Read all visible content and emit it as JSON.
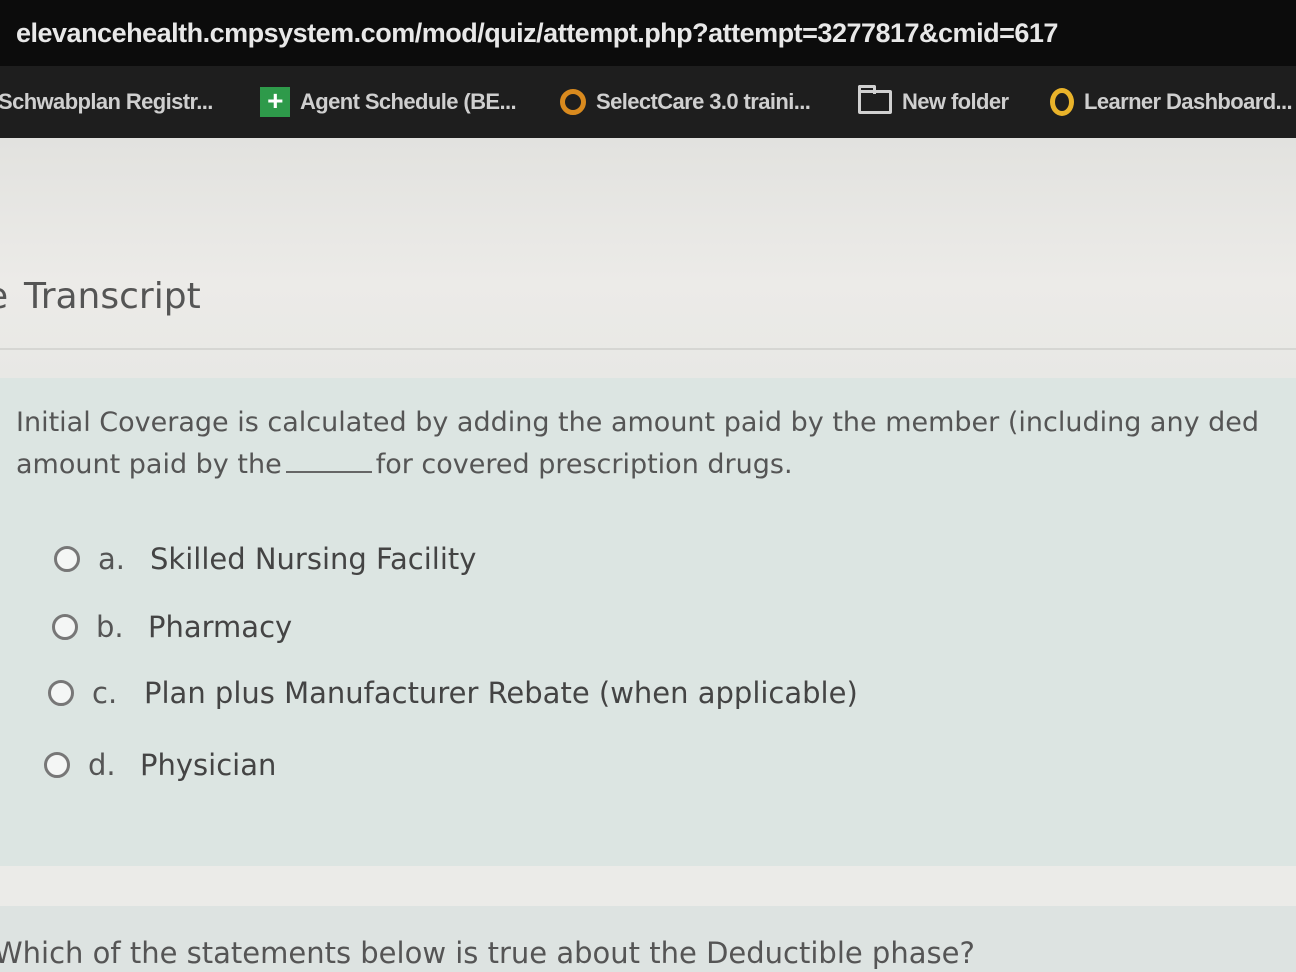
{
  "browser": {
    "url": "elevancehealth.cmpsystem.com/mod/quiz/attempt.php?attempt=3277817&cmid=617",
    "bookmarks": [
      {
        "label": "Schwabplan Registr...",
        "icon": "none"
      },
      {
        "label": "Agent Schedule (BE...",
        "icon": "green-plus-icon"
      },
      {
        "label": "SelectCare 3.0 traini...",
        "icon": "orange-ring-icon"
      },
      {
        "label": "New folder",
        "icon": "folder-icon"
      },
      {
        "label": "Learner Dashboard...",
        "icon": "yellow-ring-icon"
      }
    ]
  },
  "page": {
    "section_title": "Transcript",
    "question1": {
      "line1": "Initial Coverage is calculated by adding the amount paid by the member (including any ded",
      "line2_before": "amount paid by the",
      "line2_after": "for covered prescription drugs.",
      "options": [
        {
          "letter": "a.",
          "text": "Skilled Nursing Facility"
        },
        {
          "letter": "b.",
          "text": "Pharmacy"
        },
        {
          "letter": "c.",
          "text": "Plan plus Manufacturer Rebate (when applicable)"
        },
        {
          "letter": "d.",
          "text": "Physician"
        }
      ]
    },
    "question2": {
      "text": "Which of the statements below is true about the Deductible phase?"
    }
  },
  "colors": {
    "url_bar_bg": "#0c0c0c",
    "bookmarks_bg": "#1e1e1e",
    "question_bg": "#dce5e2",
    "agent_schedule_icon": "#2e9a4a",
    "selectcare_icon": "#d98a1e",
    "learner_icon": "#e9b32a"
  }
}
